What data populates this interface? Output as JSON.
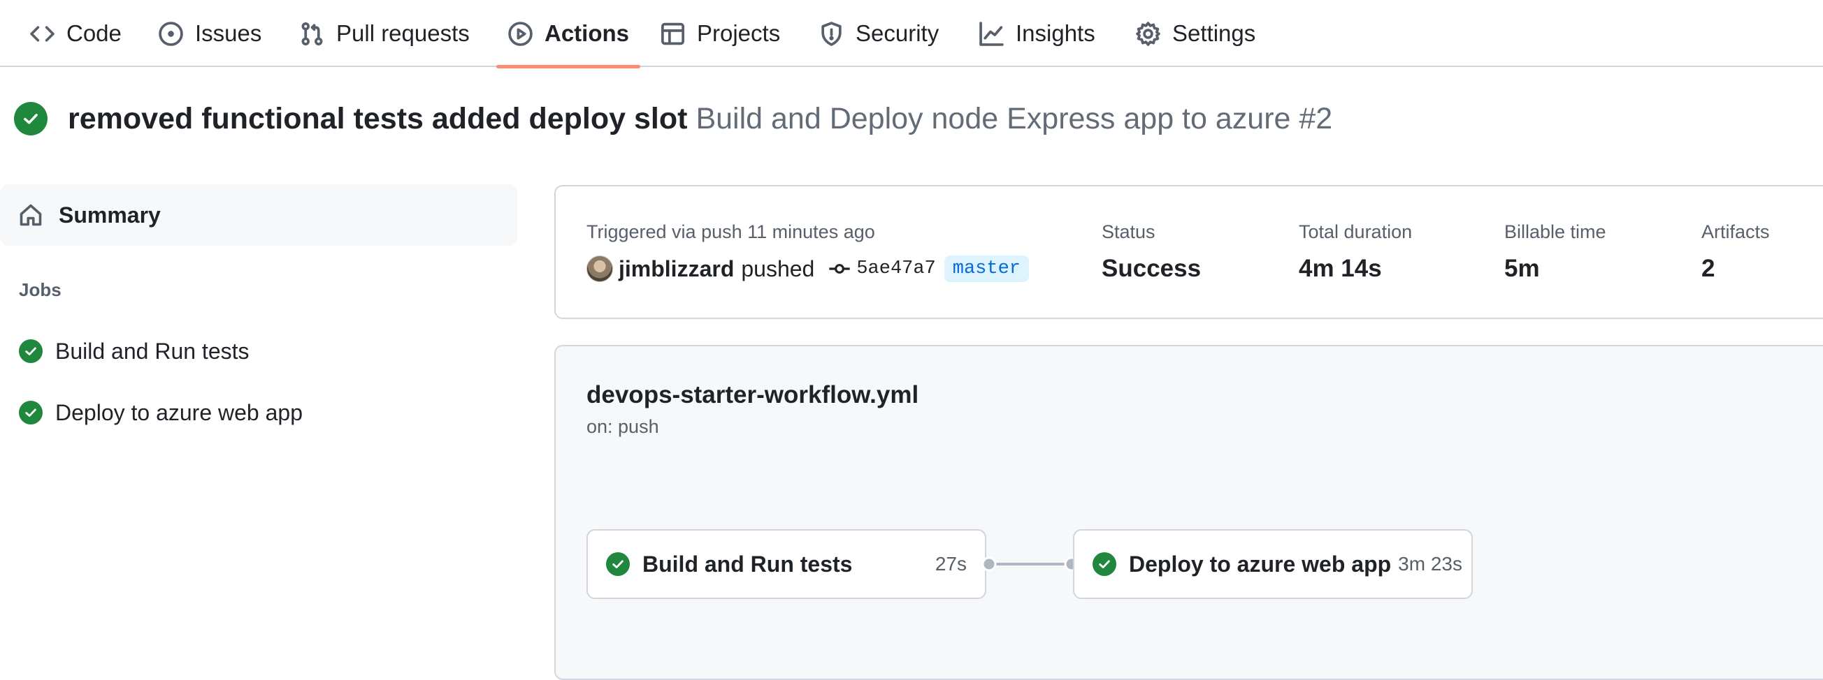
{
  "nav": {
    "tabs": [
      {
        "label": "Code",
        "icon": "code-icon"
      },
      {
        "label": "Issues",
        "icon": "issue-opened-icon"
      },
      {
        "label": "Pull requests",
        "icon": "git-pull-request-icon"
      },
      {
        "label": "Actions",
        "icon": "play-icon",
        "active": true
      },
      {
        "label": "Projects",
        "icon": "table-icon"
      },
      {
        "label": "Security",
        "icon": "shield-icon"
      },
      {
        "label": "Insights",
        "icon": "graph-icon"
      },
      {
        "label": "Settings",
        "icon": "gear-icon"
      }
    ]
  },
  "run": {
    "status_icon": "check-circle-fill-icon",
    "title": "removed functional tests added deploy slot",
    "subtitle": "Build and Deploy node Express app to azure #2"
  },
  "sidebar": {
    "summary_label": "Summary",
    "jobs_heading": "Jobs",
    "jobs": [
      {
        "label": "Build and Run tests",
        "status": "success"
      },
      {
        "label": "Deploy to azure web app",
        "status": "success"
      }
    ]
  },
  "summary": {
    "trigger_text": "Triggered via push 11 minutes ago",
    "actor": "jimblizzard",
    "action": "pushed",
    "commit_sha": "5ae47a7",
    "branch": "master",
    "status_label": "Status",
    "status_value": "Success",
    "duration_label": "Total duration",
    "duration_value": "4m 14s",
    "billable_label": "Billable time",
    "billable_value": "5m",
    "artifacts_label": "Artifacts",
    "artifacts_value": "2"
  },
  "workflow": {
    "file": "devops-starter-workflow.yml",
    "trigger": "on: push",
    "jobs": [
      {
        "name": "Build and Run tests",
        "duration": "27s"
      },
      {
        "name": "Deploy to azure web app",
        "duration": "3m 23s"
      }
    ]
  },
  "colors": {
    "success": "#1f883d",
    "active_tab_underline": "#fd8c73",
    "branch_bg": "#ddf4ff",
    "branch_fg": "#0969da"
  }
}
